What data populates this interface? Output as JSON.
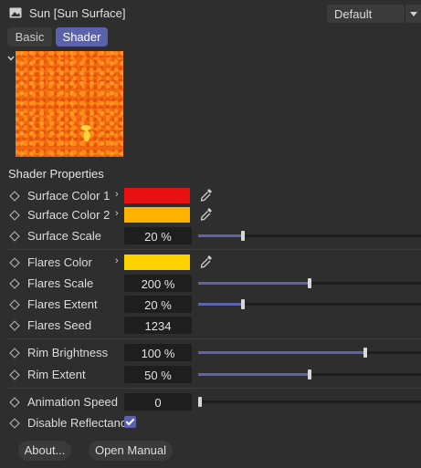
{
  "header": {
    "title": "Sun [Sun Surface]",
    "preset": "Default",
    "icon": "image-icon"
  },
  "tabs": [
    {
      "label": "Basic",
      "active": false
    },
    {
      "label": "Shader",
      "active": true
    }
  ],
  "section_title": "Shader Properties",
  "properties": {
    "surface_color_1": {
      "label": "Surface Color 1",
      "color": "#e81010"
    },
    "surface_color_2": {
      "label": "Surface Color 2",
      "color": "#ffb300"
    },
    "surface_scale": {
      "label": "Surface Scale",
      "value": "20 %",
      "slider": 0.2
    },
    "flares_color": {
      "label": "Flares Color",
      "color": "#ffd300"
    },
    "flares_scale": {
      "label": "Flares Scale",
      "value": "200 %",
      "slider": 0.5
    },
    "flares_extent": {
      "label": "Flares Extent",
      "value": "20 %",
      "slider": 0.2
    },
    "flares_seed": {
      "label": "Flares Seed",
      "value": "1234"
    },
    "rim_brightness": {
      "label": "Rim Brightness",
      "value": "100 %",
      "slider": 0.75
    },
    "rim_extent": {
      "label": "Rim Extent",
      "value": "50 %",
      "slider": 0.5
    },
    "animation_speed": {
      "label": "Animation Speed",
      "value": "0",
      "slider": 0.0
    },
    "disable_reflectance": {
      "label": "Disable Reflectance",
      "checked": true
    }
  },
  "buttons": {
    "about": "About...",
    "manual": "Open Manual"
  },
  "colors": {
    "accent": "#5a62ad",
    "panel": "#2e2e2e",
    "field": "#1e1e1e"
  }
}
